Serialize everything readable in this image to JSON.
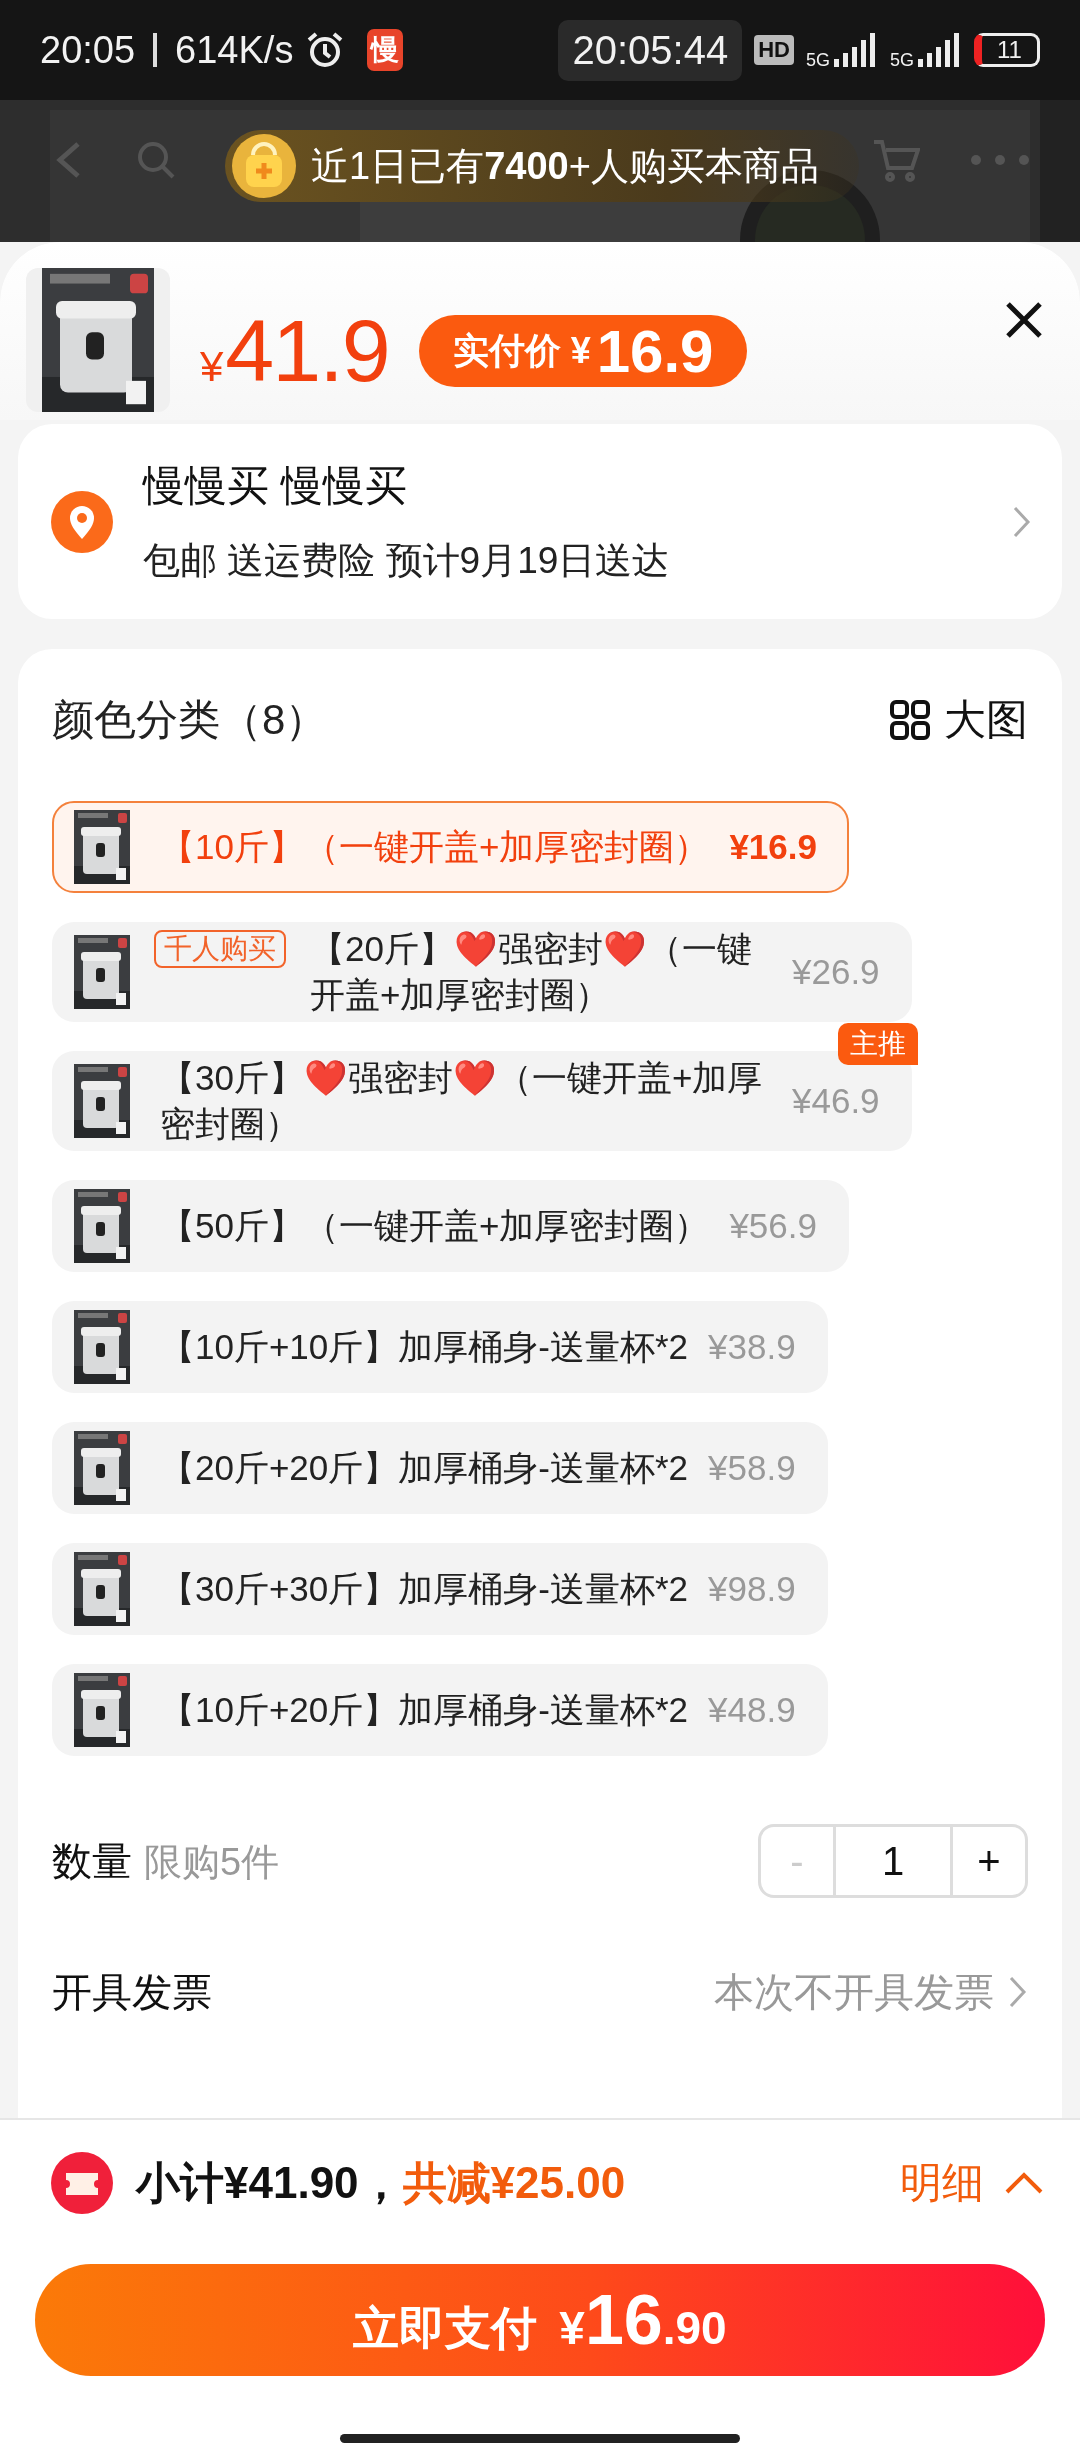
{
  "status_bar": {
    "time": "20:05",
    "speed": "614K/s",
    "app_badge": "慢",
    "clock": "20:05:44",
    "hd": "HD",
    "network_1": "5G",
    "network_2": "5G",
    "battery": "11"
  },
  "banner": {
    "text": "近1日已有**7400**+人购买本商品"
  },
  "header": {
    "currency": "¥",
    "price": "41.9",
    "pay_label": "实付价",
    "pay_currency": "¥",
    "pay_price": "16.9"
  },
  "address": {
    "name": "慢慢买 慢慢买",
    "detail": "包邮 送运费险 预计9月19日送达"
  },
  "options": {
    "title": "颜色分类（8）",
    "view_toggle": "大图",
    "items": [
      {
        "label": "【10斤】（一键开盖+加厚密封圈）",
        "price": "¥16.9",
        "selected": true
      },
      {
        "tag": "千人购买",
        "label": "【20斤】❤️强密封❤️（一键开盖+加厚密封圈）",
        "price": "¥26.9",
        "selected": false
      },
      {
        "corner_tag": "主推",
        "label": "【30斤】❤️强密封❤️（一键开盖+加厚密封圈）",
        "price": "¥46.9",
        "selected": false
      },
      {
        "label": "【50斤】（一键开盖+加厚密封圈）",
        "price": "¥56.9",
        "selected": false
      },
      {
        "label": "【10斤+10斤】加厚桶身-送量杯*2",
        "price": "¥38.9",
        "selected": false
      },
      {
        "label": "【20斤+20斤】加厚桶身-送量杯*2",
        "price": "¥58.9",
        "selected": false
      },
      {
        "label": "【30斤+30斤】加厚桶身-送量杯*2",
        "price": "¥98.9",
        "selected": false
      },
      {
        "label": "【10斤+20斤】加厚桶身-送量杯*2",
        "price": "¥48.9",
        "selected": false
      }
    ]
  },
  "quantity": {
    "label": "数量",
    "limit": "限购5件",
    "minus": "-",
    "value": "1",
    "plus": "+",
    "decrease_disabled": true
  },
  "rows": [
    {
      "label": "开具发票",
      "value": "本次不开具发票"
    }
  ],
  "footer": {
    "subtotal": "小计¥41.90，",
    "discount": "共减¥25.00",
    "details": "明细",
    "pay_label": "立即支付",
    "pay_currency": "¥",
    "pay_integer": "16",
    "pay_decimal": ".90"
  }
}
